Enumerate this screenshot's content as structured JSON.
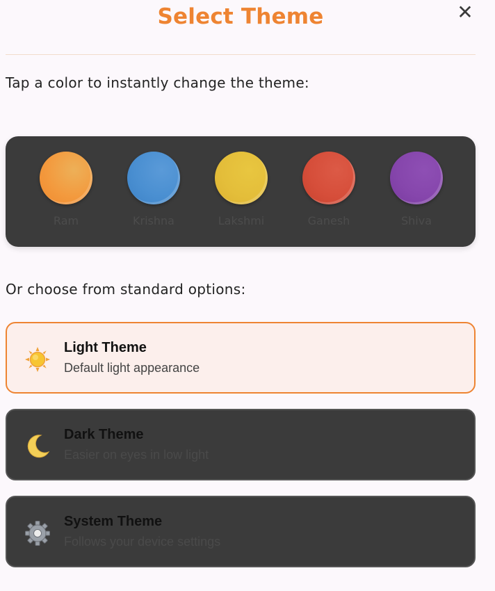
{
  "header": {
    "title": "Select Theme",
    "close_symbol": "✕"
  },
  "intro_text": "Tap a color to instantly change the theme:",
  "palette": {
    "swatches": [
      {
        "label": "Ram",
        "color": "#f0973f"
      },
      {
        "label": "Krishna",
        "color": "#4a8fd1"
      },
      {
        "label": "Lakshmi",
        "color": "#e4be3a"
      },
      {
        "label": "Ganesh",
        "color": "#d64e3a"
      },
      {
        "label": "Shiva",
        "color": "#8646ac"
      }
    ]
  },
  "options_heading": "Or choose from standard options:",
  "options": [
    {
      "name": "Light Theme",
      "description": "Default light appearance",
      "icon": "sun-icon",
      "selected": true
    },
    {
      "name": "Dark Theme",
      "description": "Easier on eyes in low light",
      "icon": "crescent-moon-icon",
      "selected": false
    },
    {
      "name": "System Theme",
      "description": "Follows your device settings",
      "icon": "gear-icon",
      "selected": false
    }
  ],
  "colors": {
    "accent": "#ee8432",
    "card_dark": "#3b3b3b",
    "background": "#fcf8fc",
    "selected_bg": "#fcefec"
  }
}
